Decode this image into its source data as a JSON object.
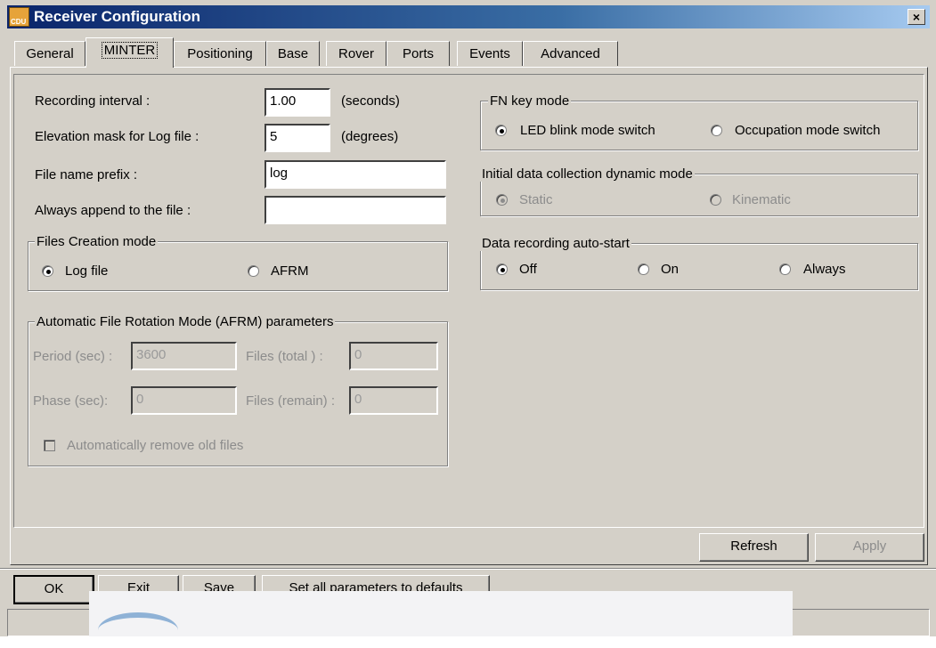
{
  "window": {
    "title": "Receiver Configuration",
    "icon_text": "CDU",
    "close_label": "×"
  },
  "tabs": [
    "General",
    "MINTER",
    "Positioning",
    "Base",
    "Rover",
    "Ports",
    "Events",
    "Advanced"
  ],
  "active_tab": "MINTER",
  "recording": {
    "interval_label": "Recording interval :",
    "interval_value": "1.00",
    "interval_unit": "(seconds)",
    "elevation_label": "Elevation mask for Log file :",
    "elevation_value": "5",
    "elevation_unit": "(degrees)",
    "prefix_label": "File name prefix :",
    "prefix_value": "log",
    "append_label": "Always append to the file :",
    "append_value": ""
  },
  "files_creation": {
    "title": "Files Creation mode",
    "options": [
      "Log file",
      "AFRM"
    ],
    "selected": "Log file"
  },
  "afrm": {
    "title": "Automatic File Rotation Mode (AFRM) parameters",
    "period_label": "Period (sec) :",
    "period_value": "3600",
    "files_total_label": "Files (total ) :",
    "files_total_value": "0",
    "phase_label": "Phase (sec):",
    "phase_value": "0",
    "files_remain_label": "Files (remain) :",
    "files_remain_value": "0",
    "auto_remove_label": "Automatically remove old files",
    "auto_remove_checked": false
  },
  "fn_key": {
    "title": "FN key mode",
    "options": [
      "LED blink mode switch",
      "Occupation mode switch"
    ],
    "selected": "LED blink mode switch"
  },
  "dynamic_mode": {
    "title": "Initial data collection dynamic mode",
    "options": [
      "Static",
      "Kinematic"
    ],
    "selected": "Static"
  },
  "auto_start": {
    "title": "Data recording auto-start",
    "options": [
      "Off",
      "On",
      "Always"
    ],
    "selected": "Off"
  },
  "panel_buttons": {
    "refresh": "Refresh",
    "apply": "Apply"
  },
  "bottom_buttons": {
    "ok": "OK",
    "exit": "Exit",
    "save": "Save",
    "defaults": "Set all parameters to defaults"
  }
}
